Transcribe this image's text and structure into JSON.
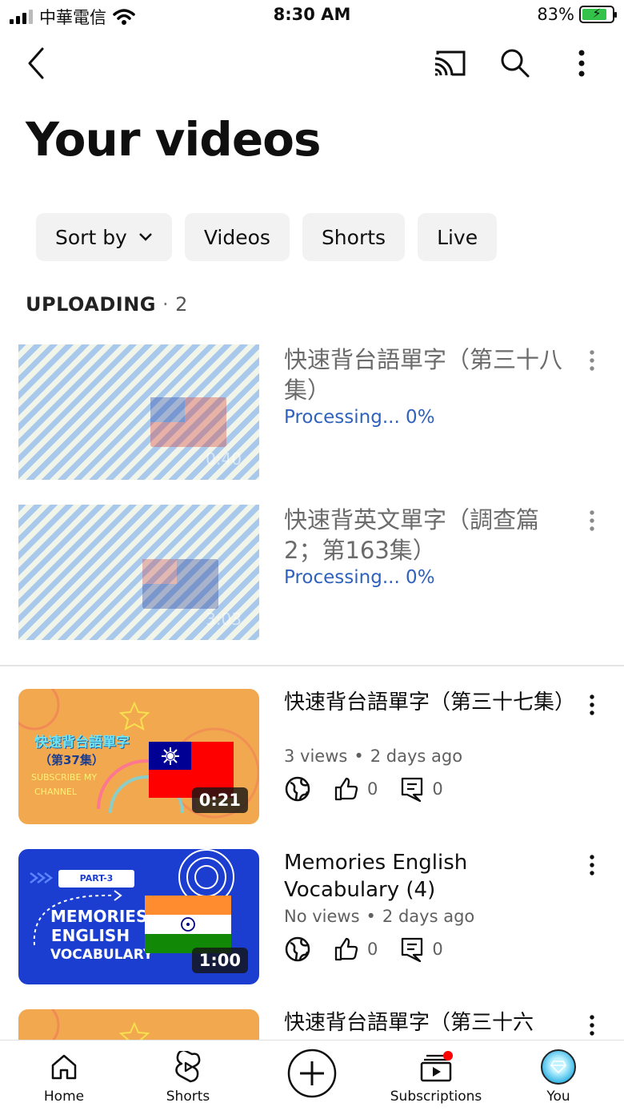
{
  "status_bar": {
    "carrier": "中華電信",
    "time": "8:30 AM",
    "battery": "83%"
  },
  "header": {
    "title": "Your videos"
  },
  "chips": [
    "Sort by",
    "Videos",
    "Shorts",
    "Live"
  ],
  "uploading": {
    "label": "UPLOADING",
    "separator": "·",
    "count": "2"
  },
  "uploads": [
    {
      "title": "快速背台語單字（第三十八集）",
      "status": "Processing... 0%",
      "duration": "0:40"
    },
    {
      "title": "快速背英文單字（調查篇2；第163集）",
      "status": "Processing... 0%",
      "duration": "3:03"
    }
  ],
  "videos": [
    {
      "title": "快速背台語單字（第三十七集）",
      "views": "3 views",
      "age": "2 days ago",
      "likes": "0",
      "comments": "0",
      "duration": "0:21",
      "thumb_text": {
        "line1": "快速背台語單字",
        "line2": "（第37集）",
        "line3": "SUBSCRIBE MY",
        "line4": "CHANNEL"
      }
    },
    {
      "title": "Memories English Vocabulary (4)",
      "views": "No views",
      "age": "2 days ago",
      "likes": "0",
      "comments": "0",
      "duration": "1:00",
      "thumb_text": {
        "part": "PART-3",
        "line1": "MEMORIES",
        "line2": "ENGLISH",
        "line3": "VOCABULARY"
      }
    },
    {
      "title": "快速背台語單字（第三十六"
    }
  ],
  "bottom_nav": {
    "home": "Home",
    "shorts": "Shorts",
    "subscriptions": "Subscriptions",
    "you": "You"
  },
  "colors": {
    "accent_link": "#2f62bd",
    "chip_bg": "#f2f2f2",
    "notification_dot": "#ff0000"
  }
}
